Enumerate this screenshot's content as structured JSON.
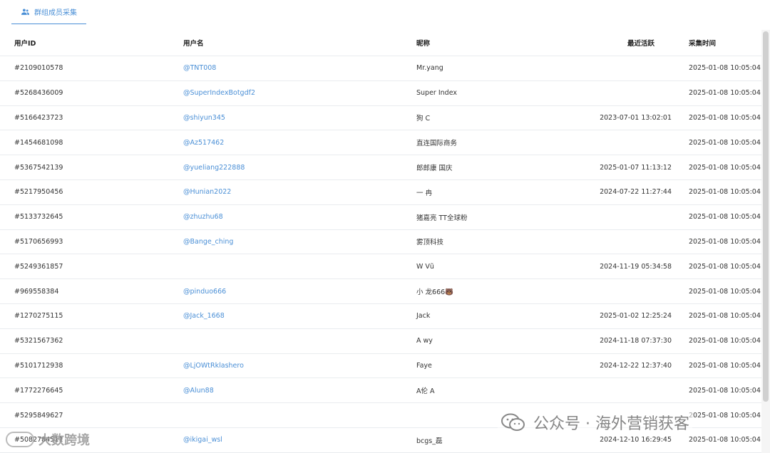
{
  "tab": {
    "label": "群组成员采集"
  },
  "columns": {
    "id": "用户ID",
    "username": "用户名",
    "nickname": "昵称",
    "last_active": "最近活跃",
    "collected": "采集时间"
  },
  "rows": [
    {
      "id": "#2109010578",
      "username": "@TNT008",
      "nickname": "Mr.yang",
      "last_active": "",
      "collected": "2025-01-08 10:05:04"
    },
    {
      "id": "#5268436009",
      "username": "@SuperIndexBotgdf2",
      "nickname": "Super Index",
      "last_active": "",
      "collected": "2025-01-08 10:05:04"
    },
    {
      "id": "#5166423723",
      "username": "@shiyun345",
      "nickname": "狗 C",
      "last_active": "2023-07-01 13:02:01",
      "collected": "2025-01-08 10:05:04"
    },
    {
      "id": "#1454681098",
      "username": "@Az517462",
      "nickname": "直连国际商务",
      "last_active": "",
      "collected": "2025-01-08 10:05:04"
    },
    {
      "id": "#5367542139",
      "username": "@yueliang222888",
      "nickname": "郎郎康 国庆",
      "last_active": "2025-01-07 11:13:12",
      "collected": "2025-01-08 10:05:04"
    },
    {
      "id": "#5217950456",
      "username": "@Hunian2022",
      "nickname": "一 冉",
      "last_active": "2024-07-22 11:27:44",
      "collected": "2025-01-08 10:05:04"
    },
    {
      "id": "#5133732645",
      "username": "@zhuzhu68",
      "nickname": "猪嘉亮 TT全球粉",
      "last_active": "",
      "collected": "2025-01-08 10:05:04"
    },
    {
      "id": "#5170656993",
      "username": "@Bange_ching",
      "nickname": "雾顶科技",
      "last_active": "",
      "collected": "2025-01-08 10:05:04"
    },
    {
      "id": "#5249361857",
      "username": "",
      "nickname": "W Vũ",
      "last_active": "2024-11-19 05:34:58",
      "collected": "2025-01-08 10:05:04"
    },
    {
      "id": "#969558384",
      "username": "@pinduo666",
      "nickname": "小 龙666🐻",
      "last_active": "",
      "collected": "2025-01-08 10:05:04"
    },
    {
      "id": "#1270275115",
      "username": "@Jack_1668",
      "nickname": "Jack",
      "last_active": "2025-01-02 12:25:24",
      "collected": "2025-01-08 10:05:04"
    },
    {
      "id": "#5321567362",
      "username": "",
      "nickname": "A wy",
      "last_active": "2024-11-18 07:37:30",
      "collected": "2025-01-08 10:05:04"
    },
    {
      "id": "#5101712938",
      "username": "@LjOWtRklashero",
      "nickname": "Faye",
      "last_active": "2024-12-22 12:37:40",
      "collected": "2025-01-08 10:05:04"
    },
    {
      "id": "#1772276645",
      "username": "@Alun88",
      "nickname": "A伦 A",
      "last_active": "",
      "collected": "2025-01-08 10:05:04"
    },
    {
      "id": "#5295849627",
      "username": "",
      "nickname": "",
      "last_active": "",
      "collected": "2025-01-08 10:05:04"
    },
    {
      "id": "#5082784511",
      "username": "@ikigai_wsl",
      "nickname": "bcgs_磊",
      "last_active": "2024-12-10 16:29:45",
      "collected": "2025-01-08 10:05:04"
    }
  ],
  "watermarks": {
    "left": "大数跨境",
    "right": "公众号 · 海外营销获客"
  },
  "colors": {
    "accent": "#4a8fd6",
    "border": "#e9ecef"
  },
  "icons": {
    "tab": "users-icon"
  }
}
